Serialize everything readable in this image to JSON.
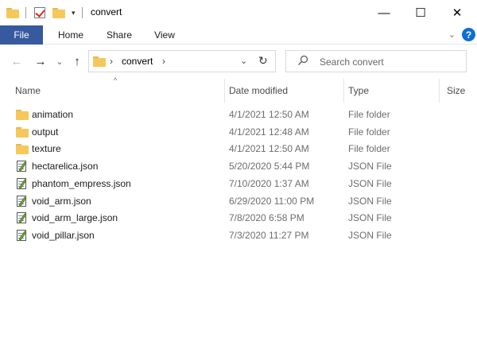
{
  "window": {
    "title": "convert",
    "minimize": "—",
    "maximize": "☐",
    "close": "✕"
  },
  "ribbon": {
    "tabs": [
      "File",
      "Home",
      "Share",
      "View"
    ],
    "expand_chevron": "⌄",
    "help": "?"
  },
  "nav": {
    "back": "←",
    "forward": "→",
    "recent": "⌄",
    "up": "↑"
  },
  "address": {
    "crumb": "convert",
    "sep": "›",
    "dropdown": "⌄",
    "refresh": "↻"
  },
  "search": {
    "placeholder": "Search convert"
  },
  "columns": {
    "name": "Name",
    "date": "Date modified",
    "type": "Type",
    "size": "Size",
    "sort_indicator": "^"
  },
  "files": [
    {
      "name": "animation",
      "date": "4/1/2021 12:50 AM",
      "type": "File folder",
      "icon": "folder-icon"
    },
    {
      "name": "output",
      "date": "4/1/2021 12:48 AM",
      "type": "File folder",
      "icon": "folder-icon"
    },
    {
      "name": "texture",
      "date": "4/1/2021 12:50 AM",
      "type": "File folder",
      "icon": "folder-icon"
    },
    {
      "name": "hectarelica.json",
      "date": "5/20/2020 5:44 PM",
      "type": "JSON File",
      "icon": "json-file-icon"
    },
    {
      "name": "phantom_empress.json",
      "date": "7/10/2020 1:37 AM",
      "type": "JSON File",
      "icon": "json-file-icon"
    },
    {
      "name": "void_arm.json",
      "date": "6/29/2020 11:00 PM",
      "type": "JSON File",
      "icon": "json-file-icon"
    },
    {
      "name": "void_arm_large.json",
      "date": "7/8/2020 6:58 PM",
      "type": "JSON File",
      "icon": "json-file-icon"
    },
    {
      "name": "void_pillar.json",
      "date": "7/3/2020 11:27 PM",
      "type": "JSON File",
      "icon": "json-file-icon"
    }
  ],
  "colors": {
    "file_tab": "#375a9e",
    "folder": "#f5c85b",
    "help": "#0f6fd1"
  }
}
